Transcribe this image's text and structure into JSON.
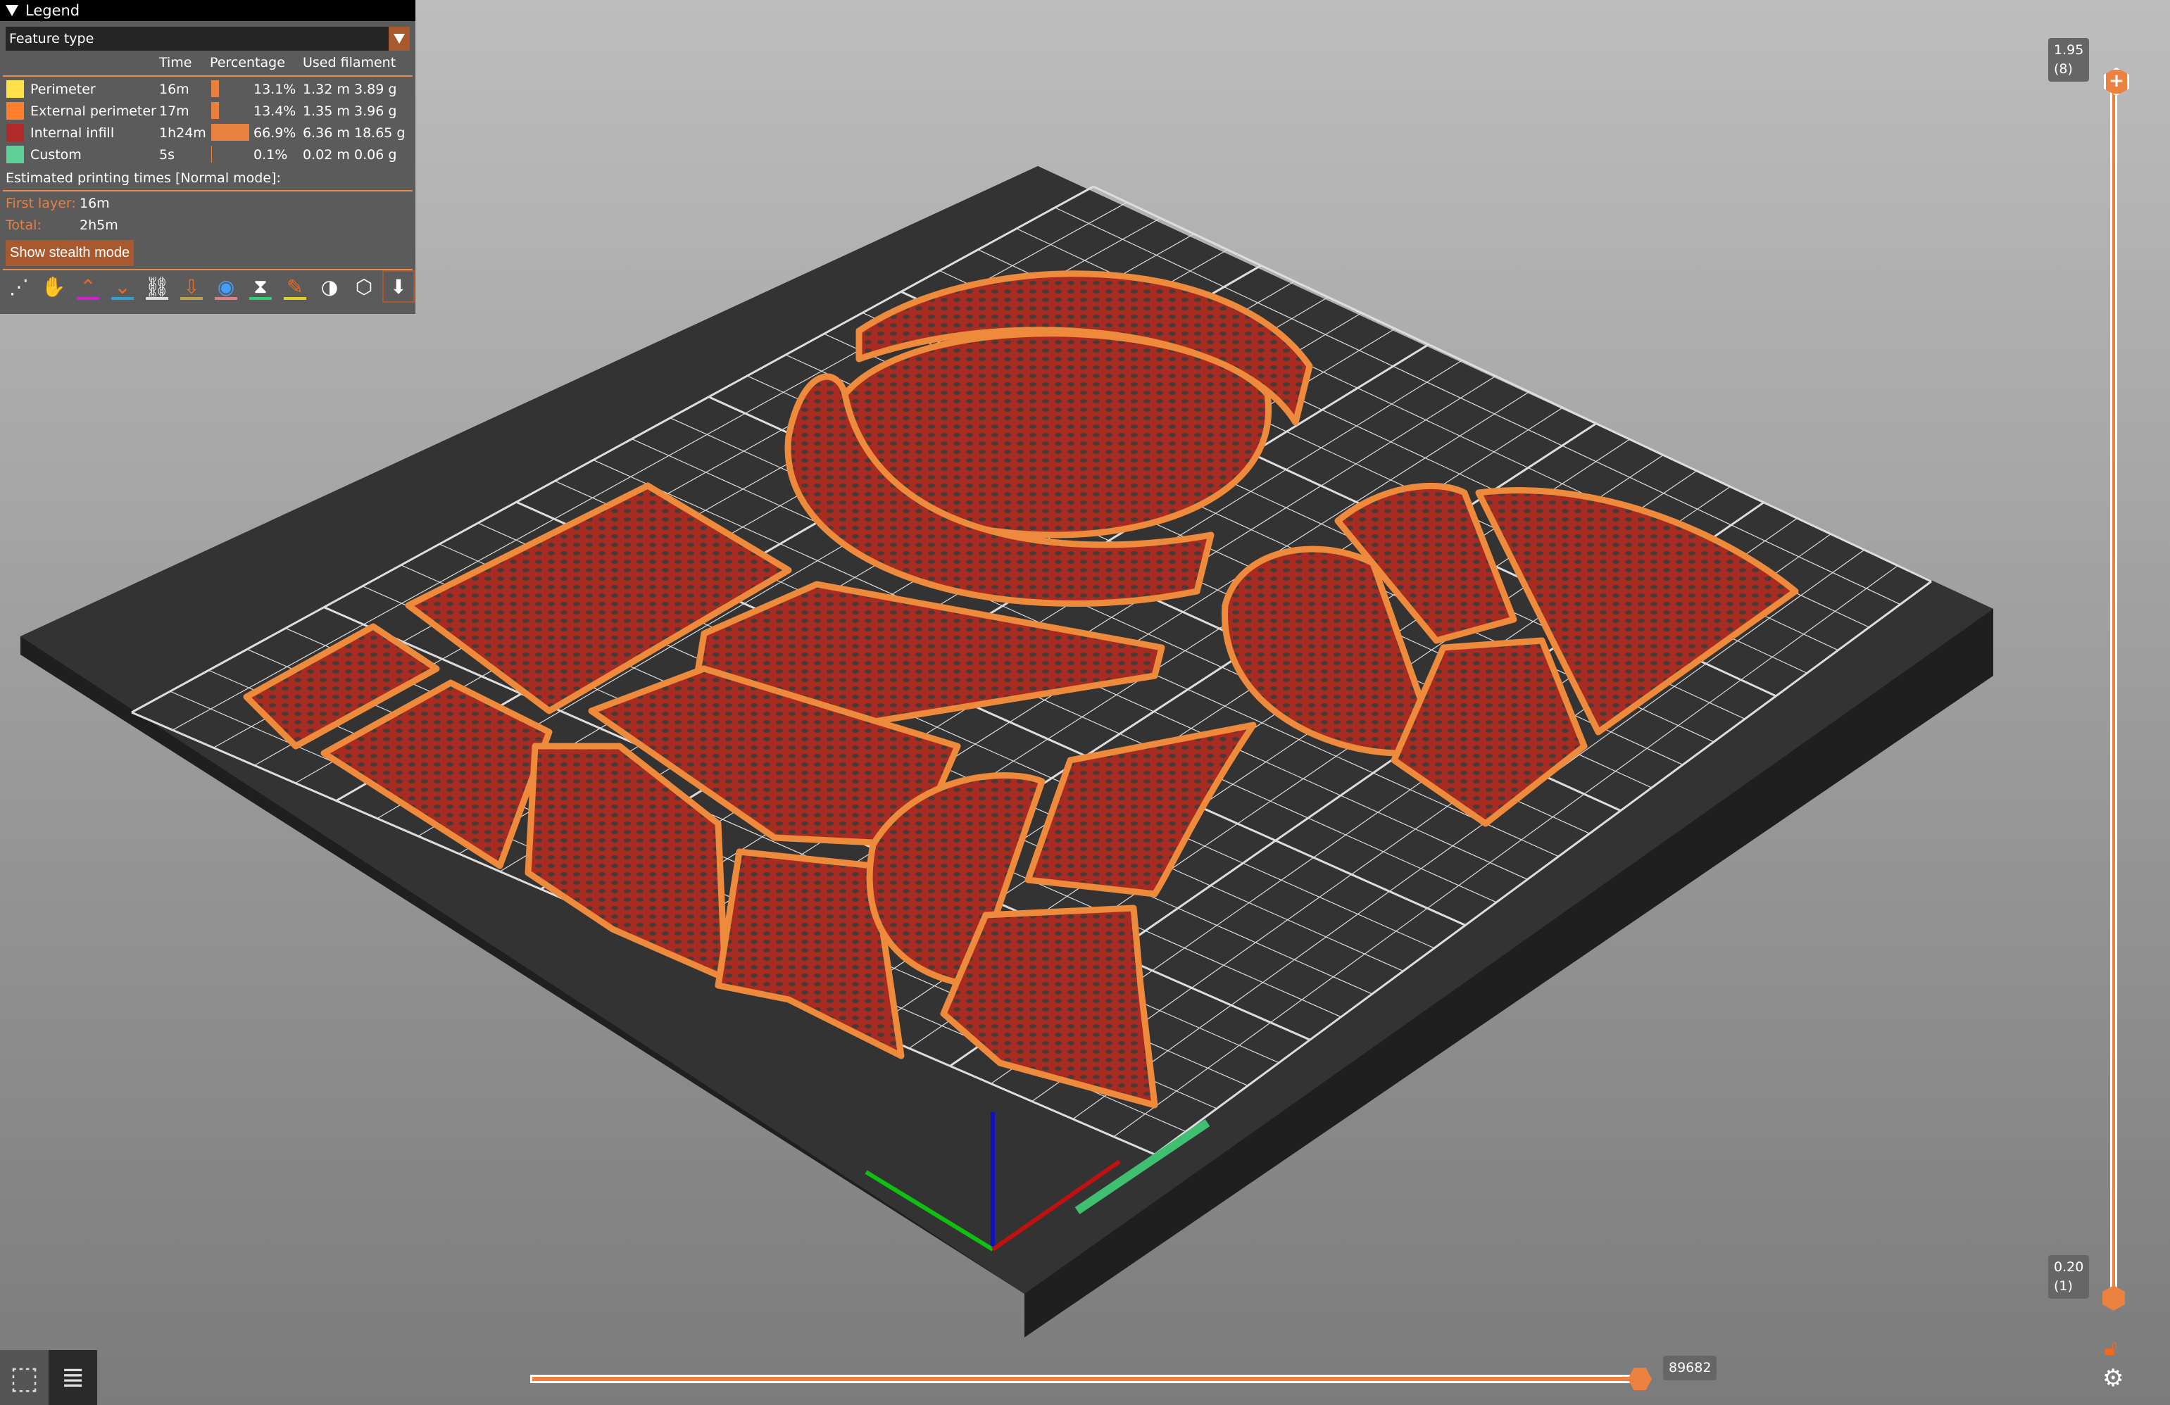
{
  "legend": {
    "title": "Legend",
    "view_type": "Feature type",
    "columns": {
      "time": "Time",
      "percentage": "Percentage",
      "used_filament": "Used filament"
    },
    "rows": [
      {
        "label": "Perimeter",
        "color": "#ffe14a",
        "time": "16m",
        "percent": "13.1%",
        "percent_value": 13.1,
        "length": "1.32 m",
        "weight": "3.89 g"
      },
      {
        "label": "External perimeter",
        "color": "#ff7f2f",
        "time": "17m",
        "percent": "13.4%",
        "percent_value": 13.4,
        "length": "1.35 m",
        "weight": "3.96 g"
      },
      {
        "label": "Internal infill",
        "color": "#b02a2a",
        "time": "1h24m",
        "percent": "66.9%",
        "percent_value": 66.9,
        "length": "6.36 m",
        "weight": "18.65 g"
      },
      {
        "label": "Custom",
        "color": "#5ed196",
        "time": "5s",
        "percent": "0.1%",
        "percent_value": 0.1,
        "length": "0.02 m",
        "weight": "0.06 g"
      }
    ],
    "estimated_title": "Estimated printing times [Normal mode]:",
    "first_layer_label": "First layer:",
    "first_layer_value": "16m",
    "total_label": "Total:",
    "total_value": "2h5m",
    "stealth_button": "Show stealth mode",
    "toolbar_icons": [
      "travel-icon",
      "wipe-icon",
      "retractions-icon",
      "deretractions-icon",
      "seams-icon",
      "tool-changes-icon",
      "color-changes-icon",
      "pause-icon",
      "custom-gcode-icon",
      "center-of-gravity-icon",
      "shells-icon",
      "tool-marker-icon"
    ]
  },
  "vertical_slider": {
    "top_value": "1.95",
    "top_layer": "(8)",
    "bottom_value": "0.20",
    "bottom_layer": "(1)"
  },
  "horizontal_slider": {
    "value": "89682",
    "position": 1.0
  },
  "colors": {
    "accent": "#ed8240",
    "bed": "#2e2e2e",
    "infill": "#a82b22",
    "perimeter": "#ee8a3c"
  }
}
